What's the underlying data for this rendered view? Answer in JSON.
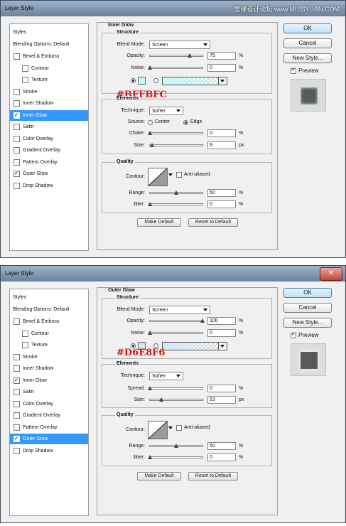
{
  "watermark": "思缘设计论坛 www.MISSYUAN.COM",
  "colors": {
    "inner_glow_hex": "#BFFBFC",
    "outer_glow_hex": "#D6E8F6",
    "selected_item": "#3399ff",
    "annotation": "#cc1a1a"
  },
  "dialogs": [
    {
      "title": "Layer Style",
      "sidebar": [
        {
          "label": "Styles",
          "checked": false,
          "header": true
        },
        {
          "label": "Blending Options: Default",
          "checked": false,
          "header": true
        },
        {
          "label": "Bevel & Emboss",
          "checked": false
        },
        {
          "label": "Contour",
          "checked": false,
          "sub": true
        },
        {
          "label": "Texture",
          "checked": false,
          "sub": true
        },
        {
          "label": "Stroke",
          "checked": false
        },
        {
          "label": "Inner Shadow",
          "checked": false
        },
        {
          "label": "Inner Glow",
          "checked": true,
          "selected": true
        },
        {
          "label": "Satin",
          "checked": false
        },
        {
          "label": "Color Overlay",
          "checked": false
        },
        {
          "label": "Gradient Overlay",
          "checked": false
        },
        {
          "label": "Pattern Overlay",
          "checked": false
        },
        {
          "label": "Outer Glow",
          "checked": true
        },
        {
          "label": "Drop Shadow",
          "checked": false
        }
      ],
      "panel": {
        "title": "Inner Glow",
        "structure": {
          "title": "Structure",
          "blend_mode_label": "Blend Mode:",
          "blend_mode": "Screen",
          "opacity_label": "Opacity:",
          "opacity": "75",
          "opacity_level": 75,
          "noise_label": "Noise:",
          "noise": "0",
          "noise_level": 0,
          "percent": "%"
        },
        "annotation": "#BFFBFC",
        "elements": {
          "title": "Elements",
          "technique_label": "Technique:",
          "technique": "Softer",
          "source_label": "Source:",
          "center_label": "Center",
          "edge_label": "Edge",
          "choke_label": "Choke:",
          "choke": "0",
          "choke_level": 0,
          "size_label": "Size:",
          "size": "9",
          "size_level": 3.6,
          "px": "px",
          "percent": "%"
        },
        "quality": {
          "title": "Quality",
          "contour_label": "Contour:",
          "antialiased_label": "Anti-aliased",
          "range_label": "Range:",
          "range": "50",
          "range_level": 50,
          "jitter_label": "Jitter:",
          "jitter": "0",
          "jitter_level": 0,
          "percent": "%"
        },
        "make_default": "Make Default",
        "reset_default": "Reset to Default"
      },
      "buttons": {
        "ok": "OK",
        "cancel": "Cancel",
        "new_style": "New Style...",
        "preview": "Preview"
      }
    },
    {
      "title": "Layer Style",
      "sidebar": [
        {
          "label": "Styles",
          "checked": false,
          "header": true
        },
        {
          "label": "Blending Options: Default",
          "checked": false,
          "header": true
        },
        {
          "label": "Bevel & Emboss",
          "checked": false
        },
        {
          "label": "Contour",
          "checked": false,
          "sub": true
        },
        {
          "label": "Texture",
          "checked": false,
          "sub": true
        },
        {
          "label": "Stroke",
          "checked": false
        },
        {
          "label": "Inner Shadow",
          "checked": false
        },
        {
          "label": "Inner Glow",
          "checked": true
        },
        {
          "label": "Satin",
          "checked": false
        },
        {
          "label": "Color Overlay",
          "checked": false
        },
        {
          "label": "Gradient Overlay",
          "checked": false
        },
        {
          "label": "Pattern Overlay",
          "checked": false
        },
        {
          "label": "Outer Glow",
          "checked": true,
          "selected": true
        },
        {
          "label": "Drop Shadow",
          "checked": false
        }
      ],
      "panel": {
        "title": "Outer Glow",
        "structure": {
          "title": "Structure",
          "blend_mode_label": "Blend Mode:",
          "blend_mode": "Screen",
          "opacity_label": "Opacity:",
          "opacity": "100",
          "opacity_level": 100,
          "noise_label": "Noise:",
          "noise": "0",
          "noise_level": 0,
          "percent": "%"
        },
        "annotation": "#D6E8F6",
        "elements": {
          "title": "Elements",
          "technique_label": "Technique:",
          "technique": "Softer",
          "spread_label": "Spread:",
          "spread": "0",
          "spread_level": 0,
          "size_label": "Size:",
          "size": "53",
          "size_level": 21.2,
          "px": "px",
          "percent": "%"
        },
        "quality": {
          "title": "Quality",
          "contour_label": "Contour:",
          "antialiased_label": "Anti-aliased",
          "range_label": "Range:",
          "range": "50",
          "range_level": 50,
          "jitter_label": "Jitter:",
          "jitter": "0",
          "jitter_level": 0,
          "percent": "%"
        },
        "make_default": "Make Default",
        "reset_default": "Reset to Default"
      },
      "buttons": {
        "ok": "OK",
        "cancel": "Cancel",
        "new_style": "New Style...",
        "preview": "Preview"
      }
    }
  ]
}
